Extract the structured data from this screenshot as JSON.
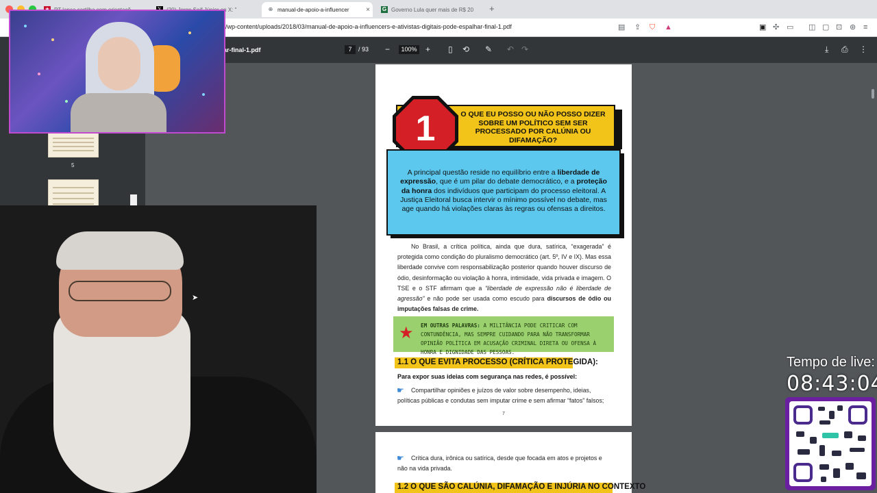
{
  "browser": {
    "tabs": [
      {
        "title": "PT lança cartilha com orientaçõ"
      },
      {
        "title": "(20) Jorge Seif Júnior on X: \""
      },
      {
        "title": "manual-de-apoio-a-influencer"
      },
      {
        "title": "Governo Lula quer mais de R$ 20"
      }
    ],
    "new_tab": "+",
    "url": "r/wp-content/uploads/2018/03/manual-de-apoio-a-influencers-e-ativistas-digitais-pode-espalhar-final-1.pdf"
  },
  "pdf": {
    "filename": "ar-final-1.pdf",
    "page_current": "7",
    "page_total": "/ 93",
    "zoom": "100%",
    "minus": "−",
    "plus": "+"
  },
  "sidebar": {
    "thumb_label": "5"
  },
  "page": {
    "number_badge": "1",
    "question": "O QUE EU POSSO OU NÃO POSSO DIZER SOBRE UM POLÍTICO SEM SER PROCESSADO POR CALÚNIA OU DIFAMAÇÃO?",
    "intro_1": "A principal questão reside no equilíbrio entre a ",
    "intro_b1": "liberdade de expressão",
    "intro_2": ", que é um pilar do debate democrático, e a ",
    "intro_b2": "proteção da honra",
    "intro_3": " dos indivíduos que participam do processo eleitoral. A Justiça Eleitoral busca intervir o mínimo possível no debate, mas age quando há violações claras às regras ou ofensas a direitos.",
    "body_1": "No Brasil, a crítica política, ainda que dura, satírica, “exagerada” é protegida como condição do pluralismo democrático (art. 5º, IV e IX). Mas essa liberdade convive com responsabilização posterior quando houver discurso de ódio, desinformação ou violação à honra, intimidade, vida privada e imagem. O TSE e o STF afirmam que a ",
    "body_italic": "“liberdade de expressão não é liberdade de agressão”",
    "body_2": " e não pode ser usada como escudo para ",
    "body_bold": "discursos de ódio ou imputações falsas de crime.",
    "green_lead": "EM OUTRAS PALAVRAS:",
    "green_text": " A MILITÂNCIA PODE CRITICAR COM CONTUNDÊNCIA, MAS SEMPRE CUIDANDO PARA NÃO TRANSFORMAR OPINIÃO POLÍTICA EM ACUSAÇÃO CRIMINAL DIRETA OU OFENSA À HONRA E DIGNIDADE DAS PESSOAS.",
    "section_1_1": "1.1 O QUE EVITA PROCESSO (CRÍTICA PROTEGIDA):",
    "expose_line": "Para expor suas ideias com segurança nas redes, é possível:",
    "bullet_1": "Compartilhar opiniões e juízos de valor sobre desempenho, ideias, políticas públicas e condutas sem imputar crime e sem afirmar “fatos” falsos;",
    "page_number": "7",
    "bullet_2": "Crítica dura, irônica ou satírica, desde que focada em atos e projetos e não na vida privada.",
    "section_1_2": "1.2 O QUE SÃO CALÚNIA, DIFAMAÇÃO E INJÚRIA NO CONTEXTO"
  },
  "overlay": {
    "live_label": "Tempo de live:",
    "live_time": "08:43:04"
  },
  "colors": {
    "accent_yellow": "#f2c318",
    "accent_blue": "#5cc8ee",
    "accent_red": "#d41f26",
    "accent_green": "#9ad06d"
  }
}
